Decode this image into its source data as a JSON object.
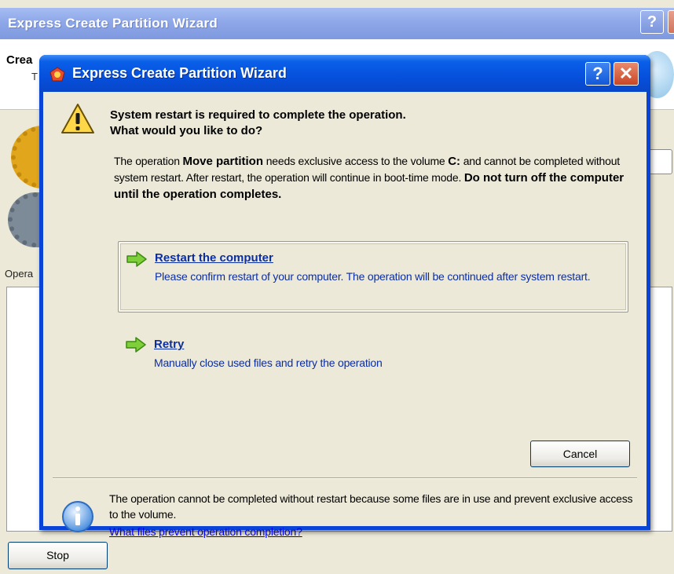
{
  "background_window": {
    "title": "Express Create Partition Wizard",
    "header_title_partial": "Crea",
    "header_sub_partial": "T",
    "operations_label_partial": "Opera",
    "stop_button": "Stop"
  },
  "dialog": {
    "title": "Express Create Partition Wizard",
    "headline_line1": "System restart is required to complete the operation.",
    "headline_line2": "What would you like to do?",
    "description": {
      "part1": "The operation ",
      "bold1": "Move partition",
      "part2": " needs exclusive access to the volume ",
      "bold2": "C:",
      "part3": " and cannot be completed without system restart. After restart, the operation will continue in boot-time mode. ",
      "bold3": "Do not turn off the computer until the operation completes."
    },
    "options": [
      {
        "title": "Restart the computer",
        "description": "Please confirm restart of your computer. The operation will be continued after system restart."
      },
      {
        "title": "Retry",
        "description": "Manually close used files and retry the operation"
      }
    ],
    "cancel_button": "Cancel",
    "info_text": "The operation cannot be completed without restart because some files are in use and prevent exclusive access to the volume.",
    "info_link": "What files prevent operation completion?"
  },
  "icons": {
    "warning": "warning-icon",
    "info": "info-icon",
    "arrow": "green-arrow-icon",
    "app": "app-icon"
  },
  "colors": {
    "title_bar": "#0650dc",
    "dialog_bg": "#ece9d8",
    "link": "#0000ee",
    "option_text": "#0c2ea3"
  }
}
